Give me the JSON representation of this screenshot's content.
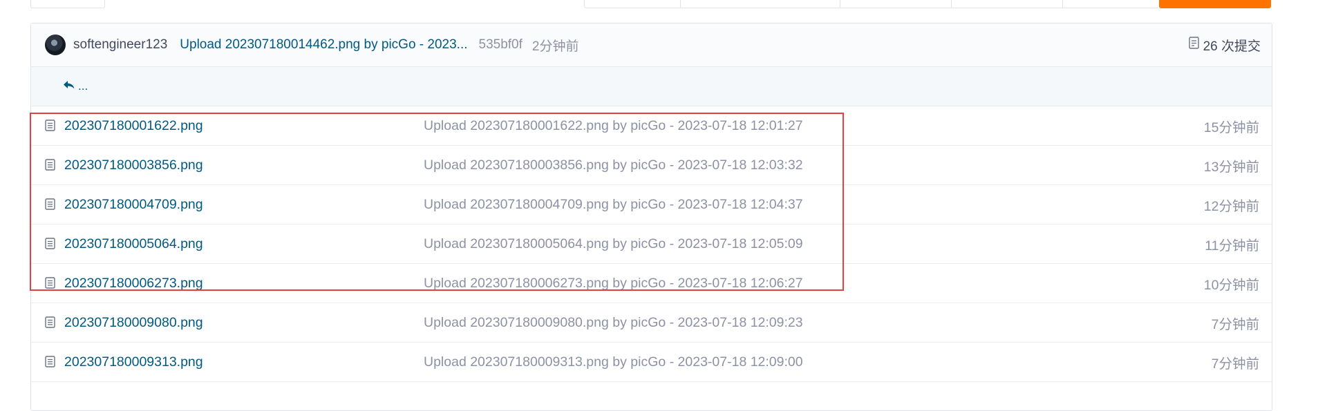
{
  "repo": {
    "latest_commit": {
      "author": "softengineer123",
      "message": "Upload 202307180014462.png by picGo - 2023...",
      "sha": "535bf0f",
      "time": "2分钟前",
      "commit_count": "26 次提交"
    },
    "back_label": "...",
    "files": [
      {
        "name": "202307180001622.png",
        "message": "Upload 202307180001622.png by picGo - 2023-07-18 12:01:27",
        "time": "15分钟前",
        "highlighted": true
      },
      {
        "name": "202307180003856.png",
        "message": "Upload 202307180003856.png by picGo - 2023-07-18 12:03:32",
        "time": "13分钟前",
        "highlighted": true
      },
      {
        "name": "202307180004709.png",
        "message": "Upload 202307180004709.png by picGo - 2023-07-18 12:04:37",
        "time": "12分钟前",
        "highlighted": true
      },
      {
        "name": "202307180005064.png",
        "message": "Upload 202307180005064.png by picGo - 2023-07-18 12:05:09",
        "time": "11分钟前",
        "highlighted": true
      },
      {
        "name": "202307180006273.png",
        "message": "Upload 202307180006273.png by picGo - 2023-07-18 12:06:27",
        "time": "10分钟前",
        "highlighted": true
      },
      {
        "name": "202307180009080.png",
        "message": "Upload 202307180009080.png by picGo - 2023-07-18 12:09:23",
        "time": "7分钟前",
        "highlighted": false
      },
      {
        "name": "202307180009313.png",
        "message": "Upload 202307180009313.png by picGo - 2023-07-18 12:09:00",
        "time": "7分钟前",
        "highlighted": false
      }
    ]
  },
  "icons": {
    "file": "file-icon",
    "back": "reply-arrow-icon",
    "commits": "commit-list-icon",
    "avatar": "user-avatar"
  },
  "colors": {
    "link": "#005980",
    "muted": "#8c92a4",
    "highlight": "#e54040",
    "accent_orange": "#fe7300"
  }
}
